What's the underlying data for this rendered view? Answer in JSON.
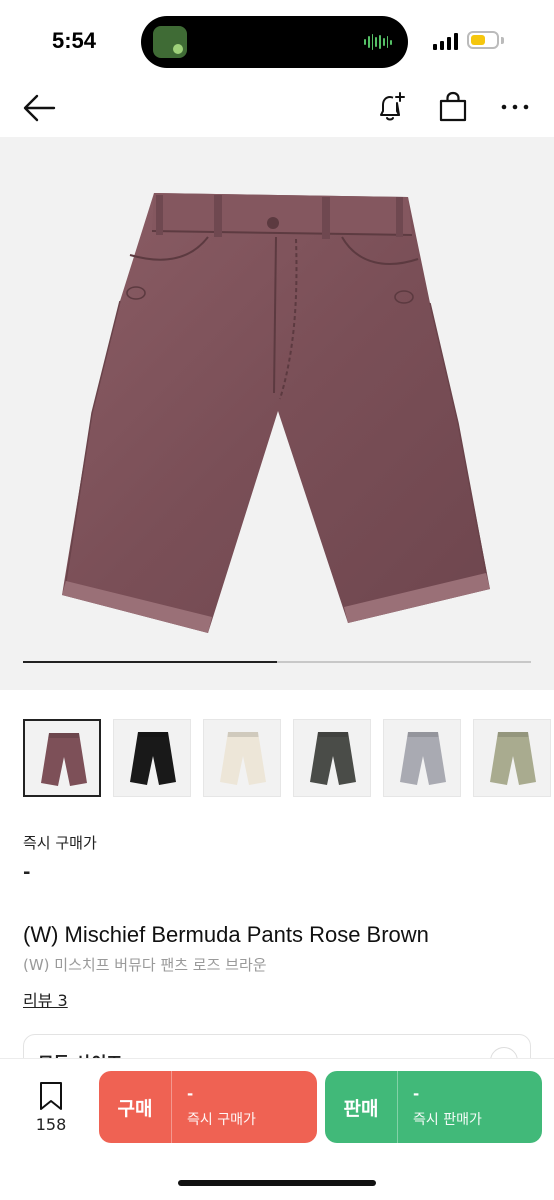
{
  "status_bar": {
    "time": "5:54"
  },
  "nav": {
    "back_icon": "arrow-left-icon",
    "alert_icon": "bell-plus-icon",
    "bag_icon": "shopping-bag-icon",
    "more_icon": "more-horizontal-icon"
  },
  "gallery": {
    "image_progress": 0.5,
    "thumbnails": [
      {
        "color": "#7d5058",
        "selected": true
      },
      {
        "color": "#191919",
        "selected": false
      },
      {
        "color": "#ede6d8",
        "selected": false
      },
      {
        "color": "#4a4c48",
        "selected": false
      },
      {
        "color": "#a9aab2",
        "selected": false
      },
      {
        "color": "#a9ab8f",
        "selected": false
      }
    ]
  },
  "product": {
    "instant_price_label": "즉시 구매가",
    "instant_price": "-",
    "title_en": "(W) Mischief Bermuda Pants Rose Brown",
    "title_ko": "(W) 미스치프 버뮤다 팬츠 로즈 브라운",
    "review_link": "리뷰 3",
    "size_selector": "모든 사이즈"
  },
  "bottom_bar": {
    "bookmark_count": "158",
    "buy": {
      "label": "구매",
      "price": "-",
      "sub": "즉시 구매가"
    },
    "sell": {
      "label": "판매",
      "price": "-",
      "sub": "즉시 판매가"
    }
  },
  "colors": {
    "buy": "#ef6253",
    "sell": "#41b979",
    "product": "#7d5058"
  }
}
